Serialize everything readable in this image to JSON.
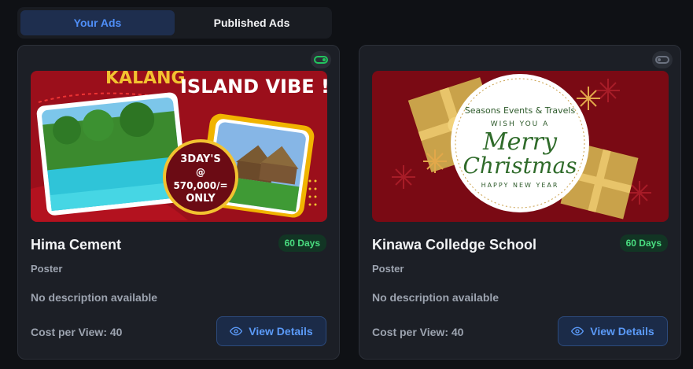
{
  "tabs": [
    {
      "label": "Your Ads",
      "active": true
    },
    {
      "label": "Published Ads",
      "active": false
    }
  ],
  "ads": [
    {
      "title": "Hima Cement",
      "days": "60 Days",
      "type": "Poster",
      "description": "No description available",
      "cost": "Cost per View: 40",
      "button": "View Details",
      "active": true,
      "image_text": {
        "headline_left": "KALANG",
        "headline_right": "ISLAND VIBE !!!",
        "offer_1": "3DAY'S",
        "offer_2": "@",
        "offer_3": "570,000/=",
        "offer_4": "ONLY"
      }
    },
    {
      "title": "Kinawa Colledge School",
      "days": "60 Days",
      "type": "Poster",
      "description": "No description available",
      "cost": "Cost per View: 40",
      "button": "View Details",
      "active": false,
      "image_text": {
        "brand": "Seasons Events & Travels",
        "wish": "WISH YOU A",
        "merry": "Merry",
        "christmas": "Christmas",
        "new_year": "HAPPY NEW YEAR"
      }
    }
  ],
  "colors": {
    "accent": "#4f8ef7",
    "badge_green": "#4ade80",
    "poster_red": "#9b0f1b"
  }
}
